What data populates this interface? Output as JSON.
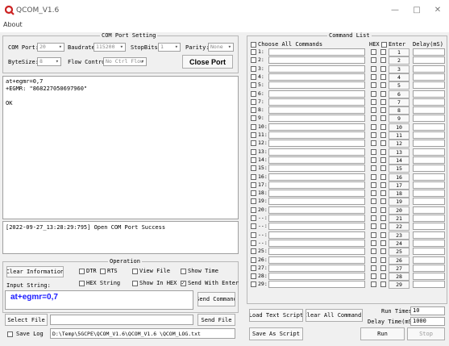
{
  "window": {
    "title": "QCOM_V1.6",
    "minimize": "—",
    "maximize": "□",
    "close": "✕"
  },
  "menu": {
    "about": "About"
  },
  "port": {
    "title": "COM Port Setting",
    "com_label": "COM Port:",
    "com_value": "20",
    "baud_label": "Baudrate:",
    "baud_value": "115200",
    "stop_label": "StopBits:",
    "stop_value": "1",
    "parity_label": "Parity:",
    "parity_value": "None",
    "bytesize_label": "ByteSize:",
    "bytesize_value": "8",
    "flow_label": "Flow Control:",
    "flow_value": "No Ctrl Flow",
    "close_btn": "Close Port"
  },
  "console": {
    "lines": [
      "at+egmr=0,7",
      "+EGMR: \"868227050697960\"",
      "",
      "OK"
    ]
  },
  "status_line": "[2022-09-27_13:28:29:795] Open COM Port Success",
  "operation": {
    "title": "Operation",
    "clear_btn": "Clear Information",
    "dtr": "DTR",
    "rts": "RTS",
    "view_file": "View File",
    "show_time": "Show Time",
    "hex_string": "HEX String",
    "show_in_hex": "Show In HEX",
    "send_with_enter": "Send With Enter",
    "input_label": "Input String:",
    "input_value": "at+egmr=0,7",
    "send_cmd_btn": "Send Command",
    "select_file_btn": "Select File",
    "send_file_btn": "Send File",
    "save_log": "Save Log",
    "log_path": "D:\\Temp\\5GCPE\\QCOM_V1.6\\QCOM_V1.6 \\QCOM_LOG.txt"
  },
  "commands": {
    "title": "Command List",
    "choose_all": "Choose All Commands",
    "hex_header": "HEX",
    "enter_header": "Enter",
    "delay_header": "Delay(mS)",
    "rows": [
      "1:",
      "2:",
      "3:",
      "4:",
      "5:",
      "6:",
      "7:",
      "8:",
      "9:",
      "10:",
      "11:",
      "12:",
      "13:",
      "14:",
      "15:",
      "16:",
      "17:",
      "18:",
      "19:",
      "20:",
      "--:",
      "--:",
      "--:",
      "--:",
      "25:",
      "26:",
      "27:",
      "28:",
      "29:"
    ],
    "buttons": [
      "1",
      "2",
      "3",
      "4",
      "5",
      "6",
      "7",
      "8",
      "9",
      "10",
      "11",
      "12",
      "13",
      "14",
      "15",
      "16",
      "17",
      "18",
      "19",
      "20",
      "21",
      "22",
      "23",
      "24",
      "25",
      "26",
      "27",
      "28",
      "29"
    ]
  },
  "bottom": {
    "load_btn": "Load Text Script",
    "clear_all_btn": "Clear All Commands",
    "run_times_label": "Run Times:",
    "run_times_value": "10",
    "delay_time_label": "Delay Time(mS):",
    "delay_time_value": "1000",
    "save_script_btn": "Save As Script",
    "run_btn": "Run",
    "stop_btn": "Stop"
  },
  "colors": {
    "accent": "#cc2222",
    "input_text": "#1a1aff"
  }
}
